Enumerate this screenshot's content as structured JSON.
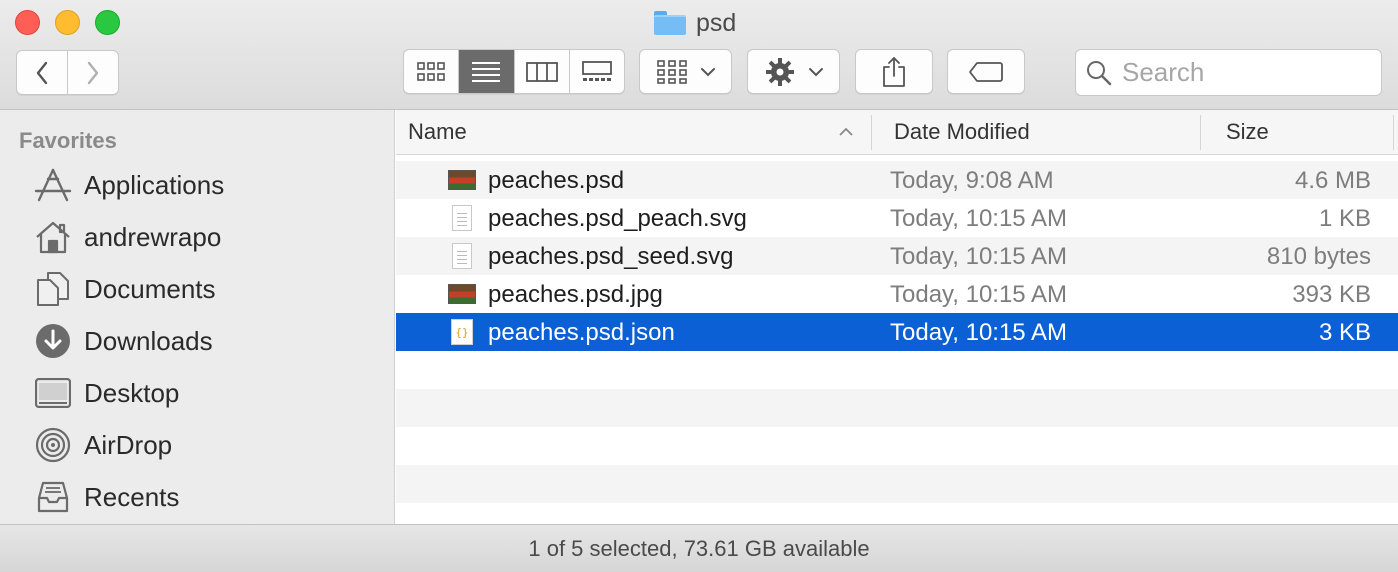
{
  "window": {
    "title": "psd"
  },
  "toolbar": {
    "back_icon": "chevron-left-icon",
    "forward_icon": "chevron-right-icon",
    "view_modes": [
      "icon-view",
      "list-view",
      "column-view",
      "gallery-view"
    ],
    "active_view": "list-view",
    "search_placeholder": "Search"
  },
  "sidebar": {
    "heading": "Favorites",
    "items": [
      {
        "label": "Applications",
        "icon": "applications-icon"
      },
      {
        "label": "andrewrapo",
        "icon": "home-icon"
      },
      {
        "label": "Documents",
        "icon": "documents-icon"
      },
      {
        "label": "Downloads",
        "icon": "downloads-icon"
      },
      {
        "label": "Desktop",
        "icon": "desktop-icon"
      },
      {
        "label": "AirDrop",
        "icon": "airdrop-icon"
      },
      {
        "label": "Recents",
        "icon": "recents-icon"
      }
    ]
  },
  "list": {
    "columns": {
      "name": "Name",
      "date": "Date Modified",
      "size": "Size"
    },
    "files": [
      {
        "name": "peaches.psd",
        "date": "Today, 9:08 AM",
        "size": "4.6 MB",
        "icon": "image-thumbnail-icon"
      },
      {
        "name": "peaches.psd_peach.svg",
        "date": "Today, 10:15 AM",
        "size": "1 KB",
        "icon": "document-icon"
      },
      {
        "name": "peaches.psd_seed.svg",
        "date": "Today, 10:15 AM",
        "size": "810 bytes",
        "icon": "document-icon"
      },
      {
        "name": "peaches.psd.jpg",
        "date": "Today, 10:15 AM",
        "size": "393 KB",
        "icon": "image-thumbnail-icon"
      },
      {
        "name": "peaches.psd.json",
        "date": "Today, 10:15 AM",
        "size": "3 KB",
        "icon": "json-file-icon",
        "selected": true
      }
    ]
  },
  "status": {
    "text": "1 of 5 selected, 73.61 GB available"
  },
  "colors": {
    "selection": "#0b60d6",
    "sidebar_bg": "#ececec"
  }
}
